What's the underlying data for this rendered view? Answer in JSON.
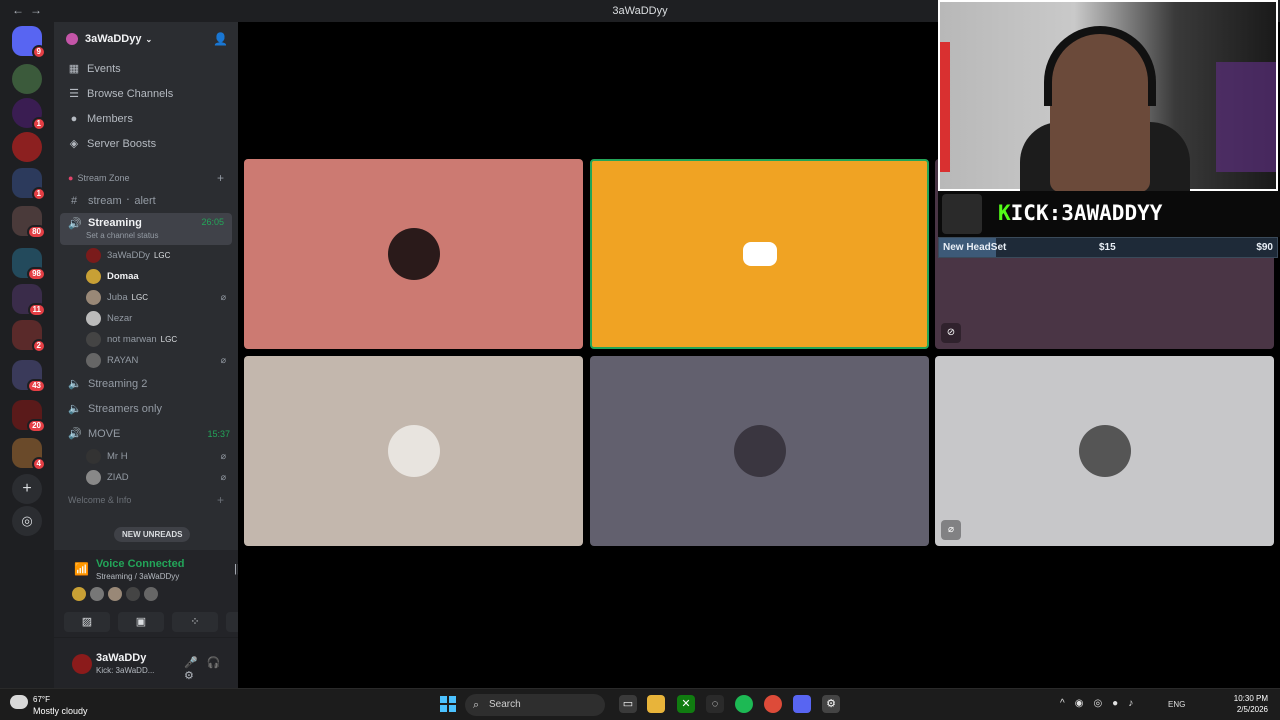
{
  "window": {
    "title": "3aWaDDyy"
  },
  "guild_badges": [
    "9",
    "",
    "1",
    "",
    "1",
    "80",
    "98",
    "11",
    "2",
    "43",
    "20",
    "4"
  ],
  "server": {
    "name": "3aWaDDyy"
  },
  "menu": [
    {
      "label": "Events",
      "icon": "calendar-icon"
    },
    {
      "label": "Browse Channels",
      "icon": "browse-icon"
    },
    {
      "label": "Members",
      "icon": "members-icon"
    },
    {
      "label": "Server Boosts",
      "icon": "boost-icon"
    }
  ],
  "category": {
    "name": "Stream Zone"
  },
  "channels": {
    "alert": "stream ᛫ alert",
    "streaming": "Streaming",
    "streaming_timer": "26:05",
    "streaming_status": "Set a channel status",
    "streaming2": "Streaming 2",
    "streamers_only": "Streamers only",
    "move": "MOVE",
    "move_timer": "15:37"
  },
  "voice_users": [
    {
      "name": "3aWaDDy",
      "tag": "LGC"
    },
    {
      "name": "Domaa",
      "tag": ""
    },
    {
      "name": "Juba",
      "tag": "LGC"
    },
    {
      "name": "Nezar",
      "tag": ""
    },
    {
      "name": "not marwan",
      "tag": "LGC"
    },
    {
      "name": "RAYAN",
      "tag": ""
    }
  ],
  "move_users": [
    {
      "name": "Mr H"
    },
    {
      "name": "ZIAD"
    }
  ],
  "new_unreads": "NEW UNREADS",
  "welcome_partial": "Welcome & Info",
  "voice": {
    "title": "Voice Connected",
    "subtitle": "Streaming / 3aWaDDyy"
  },
  "user": {
    "name": "3aWaDDy",
    "status": "Kick: 3aWaDD..."
  },
  "stream_overlay": {
    "kick_prefix": "K",
    "kick_rest": "ICK:3AWADDYY",
    "goal_label": "New HeadSet",
    "goal_current": "$15",
    "goal_target": "$90",
    "goal_progress": 0.17
  },
  "tiles": [
    {
      "color": "#cc7a72"
    },
    {
      "color": "#f0a323"
    },
    {
      "color": "#4a3545"
    },
    {
      "color": "#c3b7ad"
    },
    {
      "color": "#62606e"
    },
    {
      "color": "#c7c7c9"
    }
  ],
  "taskbar": {
    "temp": "67°F",
    "condition": "Mostly cloudy",
    "search": "Search",
    "lang": "ENG",
    "time": "10:30 PM",
    "date": "2/5/2026"
  }
}
